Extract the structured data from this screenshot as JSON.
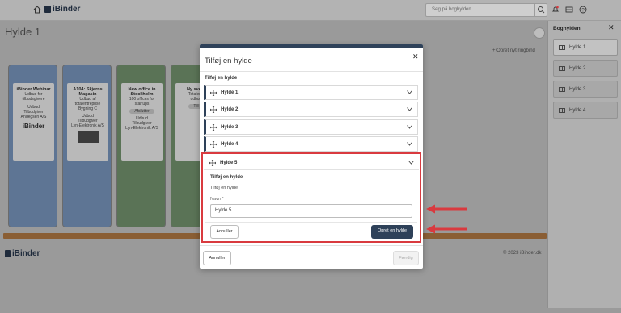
{
  "topbar": {
    "logo": "iBinder",
    "search_placeholder": "Søg på boghylden"
  },
  "page": {
    "title": "Hylde 1",
    "new_shelf_label": "+ Opret nyt ringbind",
    "footer_logo": "iBinder",
    "copyright": "© 2023 iBinder.dk"
  },
  "binders": [
    {
      "title": "iBinder Webinar",
      "lines": [
        "Udbud for",
        "tilbudsgivere",
        "",
        "Udbud",
        "Tilbudgiver",
        "Anlægsen A/S"
      ],
      "extra": "iBinder"
    },
    {
      "title": "A104: Skjerns Magasin",
      "lines": [
        "Udbud af",
        "totalentreprise",
        "Bygning C",
        "",
        "Udbud",
        "Tilbudgiver",
        "Lyn-Elektronik A/S"
      ],
      "extra": ""
    },
    {
      "title": "New office in Stockholm",
      "lines": [
        "100 offices for",
        "startups"
      ],
      "tag": "Afslutter",
      "lines2": [
        "Udbud",
        "Tilbudgiver",
        "Lyn-Elektronik A/S"
      ]
    },
    {
      "title": "Ny svøm",
      "lines": [
        "Totalentr",
        "udbud"
      ],
      "tag": "Till"
    }
  ],
  "right_panel": {
    "title": "Boghylden",
    "items": [
      "Hylde 1",
      "Hylde 2",
      "Hylde 3",
      "Hylde 4"
    ]
  },
  "modal": {
    "title": "Tilføj en hylde",
    "subheading": "Tilføj en hylde",
    "shelves": [
      "Hylde 1",
      "Hylde 2",
      "Hylde 3",
      "Hylde 4"
    ],
    "expanded": {
      "header": "Hylde 5",
      "subheading": "Tilføj en hylde",
      "subtext": "Tilføj en hylde",
      "name_label": "Navn *",
      "name_value": "Hylde 5",
      "cancel_label": "Annuller",
      "create_label": "Opret en hylde"
    },
    "footer_cancel": "Annuller",
    "footer_done": "Færdig"
  },
  "colors": {
    "accent": "#2e4159",
    "highlight": "#d93a3f",
    "shelf": "#8a5e34"
  }
}
